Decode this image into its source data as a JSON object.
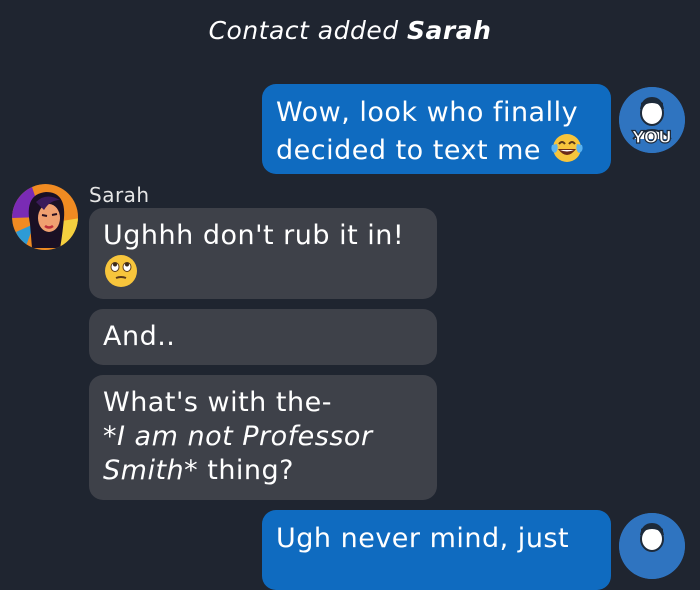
{
  "system": {
    "prefix": "Contact added",
    "name": "Sarah"
  },
  "messages": [
    {
      "from": "you",
      "text": "Wow, look who finally decided to text me",
      "emoji": "laughing-tears-emoji"
    },
    {
      "from": "Sarah",
      "text": "Ughhh don't rub it in!",
      "emoji": "eye-roll-emoji"
    },
    {
      "from": "Sarah",
      "text": "And.."
    },
    {
      "from": "Sarah",
      "line1": "What's with the-",
      "italic": "*I am not Professor Smith*",
      "tail": "thing?"
    },
    {
      "from": "you",
      "text": "Ugh never mind, just"
    }
  ],
  "contact": {
    "name": "Sarah"
  },
  "you_avatar": {
    "label": "YOU",
    "icon": "you-avatar-icon"
  },
  "colors": {
    "background": "#1f2530",
    "outgoing_bubble": "#0f6bc0",
    "incoming_bubble": "#3e4149",
    "you_avatar_bg": "#2f74c0"
  }
}
